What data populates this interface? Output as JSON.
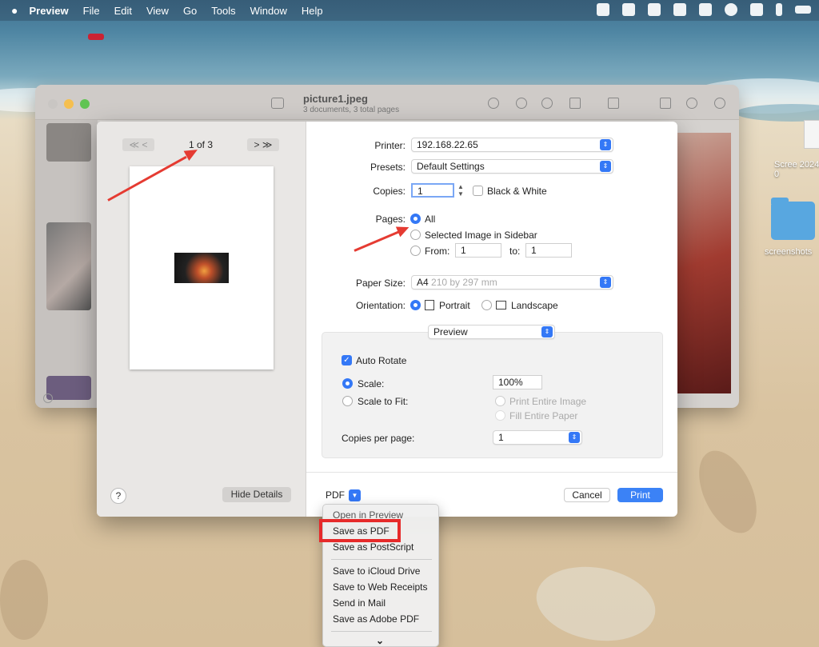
{
  "menubar": {
    "app": "Preview",
    "items": [
      "File",
      "Edit",
      "View",
      "Go",
      "Tools",
      "Window",
      "Help"
    ]
  },
  "back_window": {
    "title": "picture1.jpeg",
    "subtitle": "3 documents, 3 total pages"
  },
  "desktop": {
    "file_label": "Scree 2024-0",
    "folder_label": "screenshots"
  },
  "dialog": {
    "page_count": "1 of 3",
    "nav_first": "≪",
    "nav_prev": "<",
    "nav_next": ">",
    "nav_last": "≫",
    "help": "?",
    "hide_details": "Hide Details",
    "printer_label": "Printer:",
    "printer_value": "192.168.22.65",
    "presets_label": "Presets:",
    "presets_value": "Default Settings",
    "copies_label": "Copies:",
    "copies_value": "1",
    "bw_label": "Black & White",
    "pages_label": "Pages:",
    "pages_all": "All",
    "pages_selected": "Selected Image in Sidebar",
    "pages_from": "From:",
    "pages_from_value": "1",
    "pages_to": "to:",
    "pages_to_value": "1",
    "paper_size_label": "Paper Size:",
    "paper_size_value": "A4",
    "paper_size_dims": "210 by 297 mm",
    "orientation_label": "Orientation:",
    "portrait": "Portrait",
    "landscape": "Landscape",
    "section_popup": "Preview",
    "auto_rotate": "Auto Rotate",
    "scale_label": "Scale:",
    "scale_value": "100%",
    "scale_to_fit": "Scale to Fit:",
    "print_entire": "Print Entire Image",
    "fill_entire": "Fill Entire Paper",
    "copies_per_page_label": "Copies per page:",
    "copies_per_page_value": "1",
    "pdf": "PDF",
    "cancel": "Cancel",
    "print": "Print"
  },
  "pdf_menu": {
    "items": [
      "Open in Preview",
      "Save as PDF",
      "Save as PostScript",
      "Save to iCloud Drive",
      "Save to Web Receipts",
      "Send in Mail",
      "Save as Adobe PDF"
    ],
    "more": "⌄"
  },
  "colors": {
    "accent": "#3478f6",
    "highlight": "#e62a2a"
  }
}
